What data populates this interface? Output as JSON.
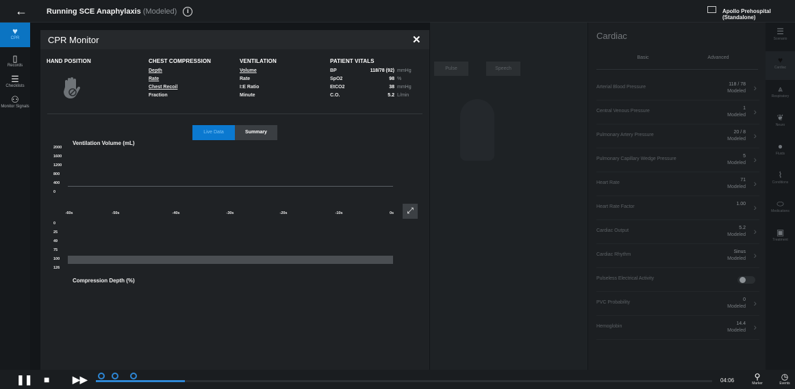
{
  "topbar": {
    "title": "Running SCE",
    "scenario": "Anaphylaxis",
    "mode": "(Modeled)",
    "info": "i",
    "app": "Apollo Prehospital (Standalone)"
  },
  "leftnav": [
    {
      "label": "CPR",
      "icon": "heart-monitor-icon",
      "glyph": "♥",
      "active": true
    },
    {
      "label": "Records",
      "icon": "clipboard-icon",
      "glyph": "▯",
      "active": false
    },
    {
      "label": "Checklists",
      "icon": "checklist-icon",
      "glyph": "☰",
      "active": false
    },
    {
      "label": "Monitor Signals",
      "icon": "person-add-icon",
      "glyph": "⚇",
      "active": false
    }
  ],
  "modal": {
    "title": "CPR Monitor",
    "close": "✕",
    "hand": {
      "heading": "HAND POSITION"
    },
    "chest": {
      "heading": "CHEST COMPRESSION",
      "items": [
        "Depth",
        "Rate",
        "Chest Recoil",
        "Fraction"
      ]
    },
    "vent": {
      "heading": "VENTILATION",
      "items": [
        "Volume",
        "Rate",
        "I:E Ratio",
        "Minute"
      ]
    },
    "vitals": {
      "heading": "PATIENT VITALS",
      "rows": [
        {
          "label": "BP",
          "value": "118/78 (92)",
          "unit": "mmHg"
        },
        {
          "label": "SpO2",
          "value": "98",
          "unit": "%"
        },
        {
          "label": "EtCO2",
          "value": "38",
          "unit": "mmHg"
        },
        {
          "label": "C.O.",
          "value": "5.2",
          "unit": "L/min"
        }
      ]
    },
    "toggle": {
      "live": "Live Data",
      "summary": "Summary"
    },
    "vent_chart": {
      "label": "Ventilation Volume (mL)",
      "yticks": [
        "2000",
        "1600",
        "1200",
        "800",
        "400",
        "0"
      ]
    },
    "x_ticks": [
      "-60s",
      "-50s",
      "-40s",
      "-30s",
      "-20s",
      "-10s",
      "0s"
    ],
    "comp_chart": {
      "label": "Compression Depth (%)",
      "yticks": [
        "0",
        "25",
        "49",
        "75",
        "100",
        "126"
      ]
    }
  },
  "background": {
    "buttons": [
      "Pulse",
      "Speech"
    ]
  },
  "cardiac": {
    "title": "Cardiac",
    "tabs": [
      "Basic",
      "Advanced"
    ],
    "rows": [
      {
        "label": "Arterial Blood Pressure",
        "value": "118 / 78",
        "sub": "Modeled"
      },
      {
        "label": "Central Venous Pressure",
        "value": "1",
        "sub": "Modeled"
      },
      {
        "label": "Pulmonary Artery Pressure",
        "value": "20 / 8",
        "sub": "Modeled"
      },
      {
        "label": "Pulmonary Capillary Wedge Pressure",
        "value": "5",
        "sub": "Modeled"
      },
      {
        "label": "Heart Rate",
        "value": "71",
        "sub": "Modeled"
      },
      {
        "label": "Heart Rate Factor",
        "value": "1.00",
        "sub": ""
      },
      {
        "label": "Cardiac Output",
        "value": "5.2",
        "sub": "Modeled"
      },
      {
        "label": "Cardiac Rhythm",
        "value": "Sinus",
        "sub": "Modeled"
      },
      {
        "label": "Pulseless Electrical Activity",
        "value": "",
        "sub": "",
        "toggle": true
      },
      {
        "label": "PVC Probability",
        "value": "0",
        "sub": "Modeled"
      },
      {
        "label": "Hemoglobin",
        "value": "14.4",
        "sub": "Modeled"
      }
    ]
  },
  "rightnav": [
    {
      "label": "Scenario",
      "icon": "list-icon",
      "glyph": "☰"
    },
    {
      "label": "Cardiac",
      "icon": "heart-icon",
      "glyph": "♥",
      "active": true
    },
    {
      "label": "Respiratory",
      "icon": "lungs-icon",
      "glyph": "⩓"
    },
    {
      "label": "Neuro",
      "icon": "brain-icon",
      "glyph": "❦"
    },
    {
      "label": "Fluids",
      "icon": "drop-icon",
      "glyph": "●"
    },
    {
      "label": "Conditions",
      "icon": "pulse-icon",
      "glyph": "⌇"
    },
    {
      "label": "Medications",
      "icon": "pill-icon",
      "glyph": "⬭"
    },
    {
      "label": "Treatment",
      "icon": "kit-icon",
      "glyph": "▣"
    }
  ],
  "bottombar": {
    "time": "04:06",
    "marker": "Marker",
    "events": "Events"
  }
}
